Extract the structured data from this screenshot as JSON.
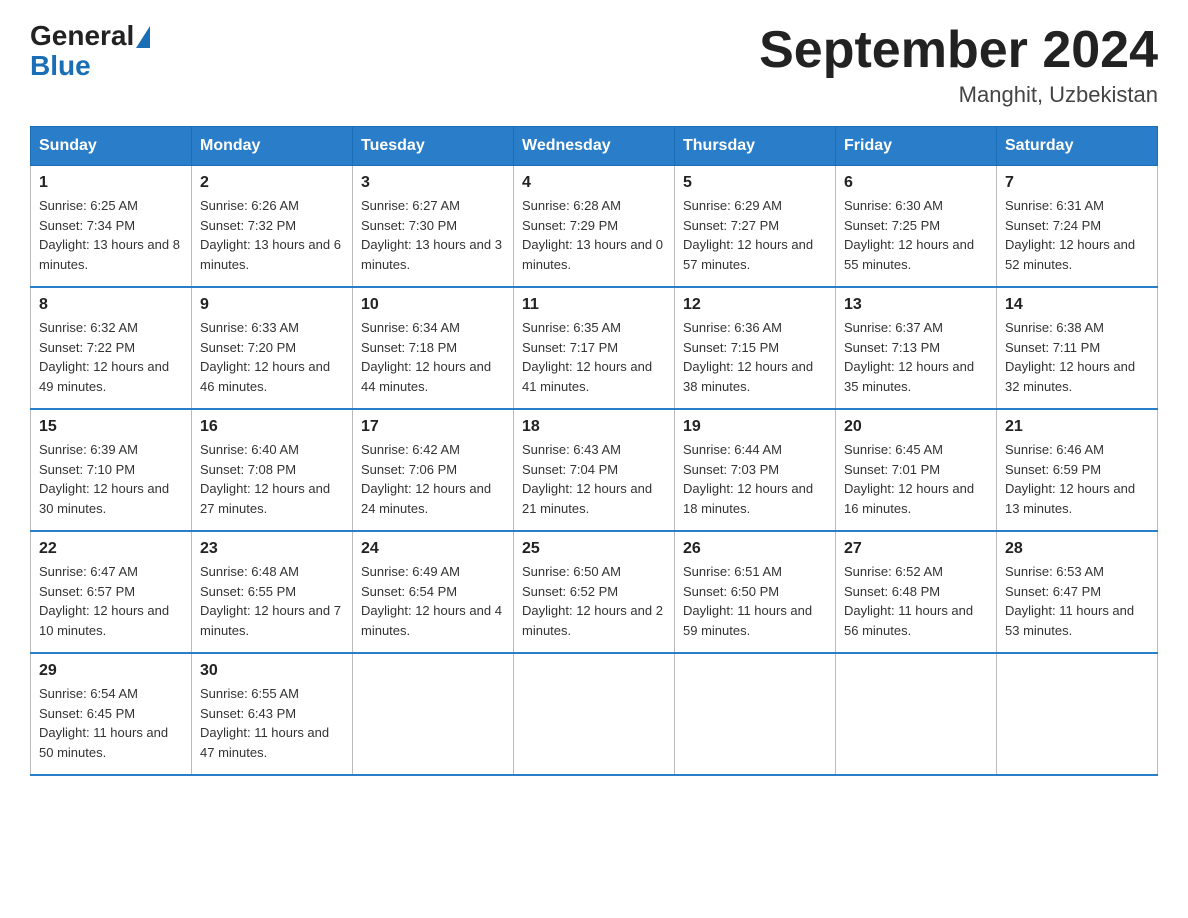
{
  "header": {
    "logo_general": "General",
    "logo_blue": "Blue",
    "title": "September 2024",
    "location": "Manghit, Uzbekistan"
  },
  "days_of_week": [
    "Sunday",
    "Monday",
    "Tuesday",
    "Wednesday",
    "Thursday",
    "Friday",
    "Saturday"
  ],
  "weeks": [
    [
      {
        "day": "1",
        "sunrise": "6:25 AM",
        "sunset": "7:34 PM",
        "daylight": "13 hours and 8 minutes."
      },
      {
        "day": "2",
        "sunrise": "6:26 AM",
        "sunset": "7:32 PM",
        "daylight": "13 hours and 6 minutes."
      },
      {
        "day": "3",
        "sunrise": "6:27 AM",
        "sunset": "7:30 PM",
        "daylight": "13 hours and 3 minutes."
      },
      {
        "day": "4",
        "sunrise": "6:28 AM",
        "sunset": "7:29 PM",
        "daylight": "13 hours and 0 minutes."
      },
      {
        "day": "5",
        "sunrise": "6:29 AM",
        "sunset": "7:27 PM",
        "daylight": "12 hours and 57 minutes."
      },
      {
        "day": "6",
        "sunrise": "6:30 AM",
        "sunset": "7:25 PM",
        "daylight": "12 hours and 55 minutes."
      },
      {
        "day": "7",
        "sunrise": "6:31 AM",
        "sunset": "7:24 PM",
        "daylight": "12 hours and 52 minutes."
      }
    ],
    [
      {
        "day": "8",
        "sunrise": "6:32 AM",
        "sunset": "7:22 PM",
        "daylight": "12 hours and 49 minutes."
      },
      {
        "day": "9",
        "sunrise": "6:33 AM",
        "sunset": "7:20 PM",
        "daylight": "12 hours and 46 minutes."
      },
      {
        "day": "10",
        "sunrise": "6:34 AM",
        "sunset": "7:18 PM",
        "daylight": "12 hours and 44 minutes."
      },
      {
        "day": "11",
        "sunrise": "6:35 AM",
        "sunset": "7:17 PM",
        "daylight": "12 hours and 41 minutes."
      },
      {
        "day": "12",
        "sunrise": "6:36 AM",
        "sunset": "7:15 PM",
        "daylight": "12 hours and 38 minutes."
      },
      {
        "day": "13",
        "sunrise": "6:37 AM",
        "sunset": "7:13 PM",
        "daylight": "12 hours and 35 minutes."
      },
      {
        "day": "14",
        "sunrise": "6:38 AM",
        "sunset": "7:11 PM",
        "daylight": "12 hours and 32 minutes."
      }
    ],
    [
      {
        "day": "15",
        "sunrise": "6:39 AM",
        "sunset": "7:10 PM",
        "daylight": "12 hours and 30 minutes."
      },
      {
        "day": "16",
        "sunrise": "6:40 AM",
        "sunset": "7:08 PM",
        "daylight": "12 hours and 27 minutes."
      },
      {
        "day": "17",
        "sunrise": "6:42 AM",
        "sunset": "7:06 PM",
        "daylight": "12 hours and 24 minutes."
      },
      {
        "day": "18",
        "sunrise": "6:43 AM",
        "sunset": "7:04 PM",
        "daylight": "12 hours and 21 minutes."
      },
      {
        "day": "19",
        "sunrise": "6:44 AM",
        "sunset": "7:03 PM",
        "daylight": "12 hours and 18 minutes."
      },
      {
        "day": "20",
        "sunrise": "6:45 AM",
        "sunset": "7:01 PM",
        "daylight": "12 hours and 16 minutes."
      },
      {
        "day": "21",
        "sunrise": "6:46 AM",
        "sunset": "6:59 PM",
        "daylight": "12 hours and 13 minutes."
      }
    ],
    [
      {
        "day": "22",
        "sunrise": "6:47 AM",
        "sunset": "6:57 PM",
        "daylight": "12 hours and 10 minutes."
      },
      {
        "day": "23",
        "sunrise": "6:48 AM",
        "sunset": "6:55 PM",
        "daylight": "12 hours and 7 minutes."
      },
      {
        "day": "24",
        "sunrise": "6:49 AM",
        "sunset": "6:54 PM",
        "daylight": "12 hours and 4 minutes."
      },
      {
        "day": "25",
        "sunrise": "6:50 AM",
        "sunset": "6:52 PM",
        "daylight": "12 hours and 2 minutes."
      },
      {
        "day": "26",
        "sunrise": "6:51 AM",
        "sunset": "6:50 PM",
        "daylight": "11 hours and 59 minutes."
      },
      {
        "day": "27",
        "sunrise": "6:52 AM",
        "sunset": "6:48 PM",
        "daylight": "11 hours and 56 minutes."
      },
      {
        "day": "28",
        "sunrise": "6:53 AM",
        "sunset": "6:47 PM",
        "daylight": "11 hours and 53 minutes."
      }
    ],
    [
      {
        "day": "29",
        "sunrise": "6:54 AM",
        "sunset": "6:45 PM",
        "daylight": "11 hours and 50 minutes."
      },
      {
        "day": "30",
        "sunrise": "6:55 AM",
        "sunset": "6:43 PM",
        "daylight": "11 hours and 47 minutes."
      },
      null,
      null,
      null,
      null,
      null
    ]
  ]
}
